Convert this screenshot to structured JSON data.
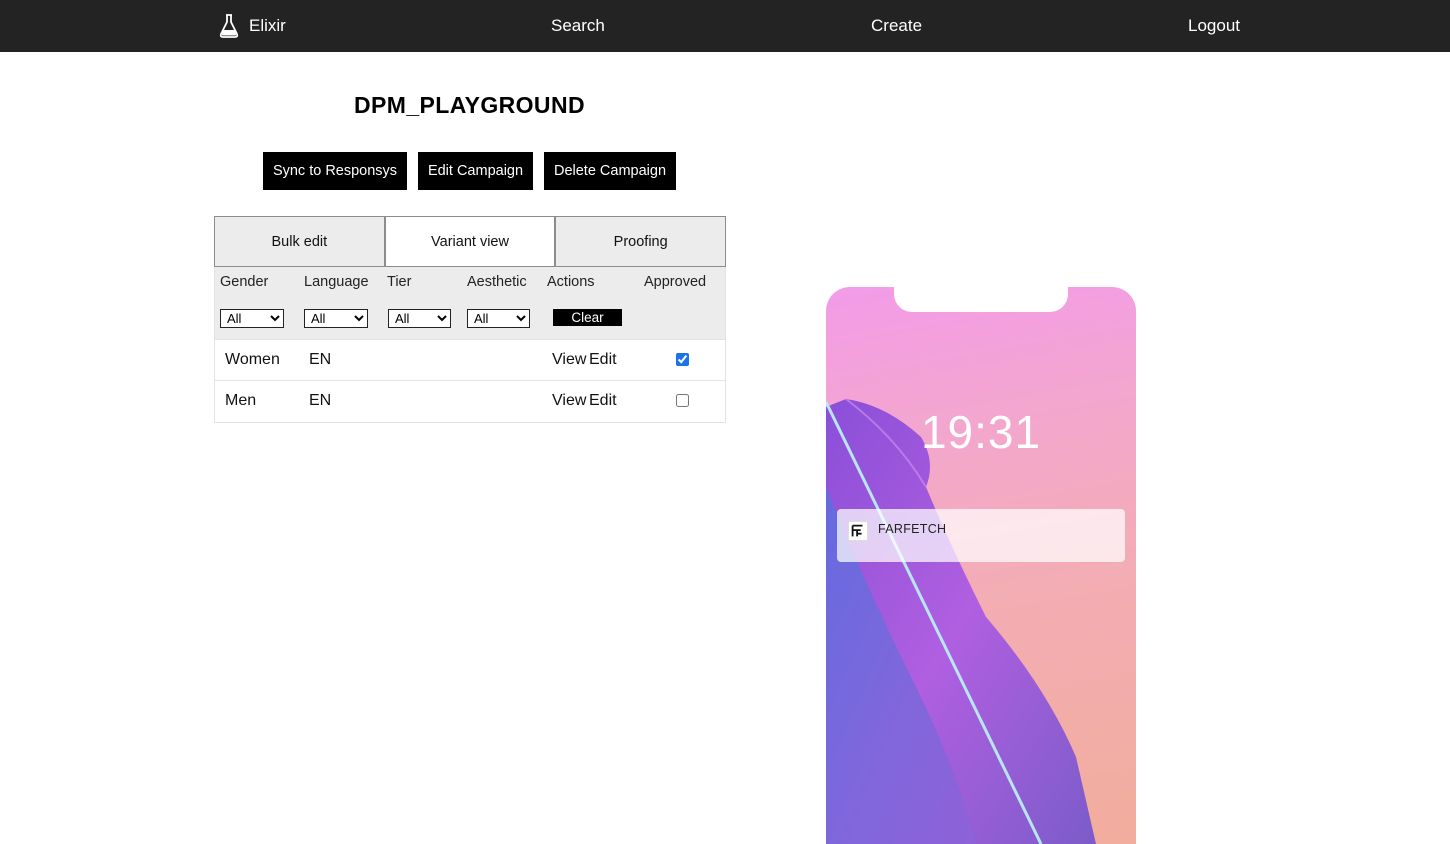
{
  "nav": {
    "brand": "Elixir",
    "search": "Search",
    "create": "Create",
    "logout": "Logout"
  },
  "campaign": {
    "title": "DPM_PLAYGROUND"
  },
  "actions": {
    "sync": "Sync to Responsys",
    "edit": "Edit Campaign",
    "delete": "Delete Campaign"
  },
  "tabs": [
    {
      "label": "Bulk edit",
      "active": false
    },
    {
      "label": "Variant view",
      "active": true
    },
    {
      "label": "Proofing",
      "active": false
    }
  ],
  "table": {
    "headers": [
      "Gender",
      "Language",
      "Tier",
      "Aesthetic",
      "Actions",
      "Approved"
    ],
    "filters": {
      "gender": "All",
      "language": "All",
      "tier": "All",
      "aesthetic": "All",
      "clear": "Clear"
    },
    "rows": [
      {
        "gender": "Women",
        "language": "EN",
        "view": "View",
        "edit": "Edit",
        "approved": true
      },
      {
        "gender": "Men",
        "language": "EN",
        "view": "View",
        "edit": "Edit",
        "approved": false
      }
    ]
  },
  "preview": {
    "time": "19:31",
    "app_name": "FARFETCH"
  },
  "icons": {
    "brand": "flask-icon",
    "app": "farfetch-logo-icon"
  },
  "colors": {
    "nav_bg": "#232323",
    "button_bg": "#000000",
    "check_accent": "#1a73e8"
  }
}
